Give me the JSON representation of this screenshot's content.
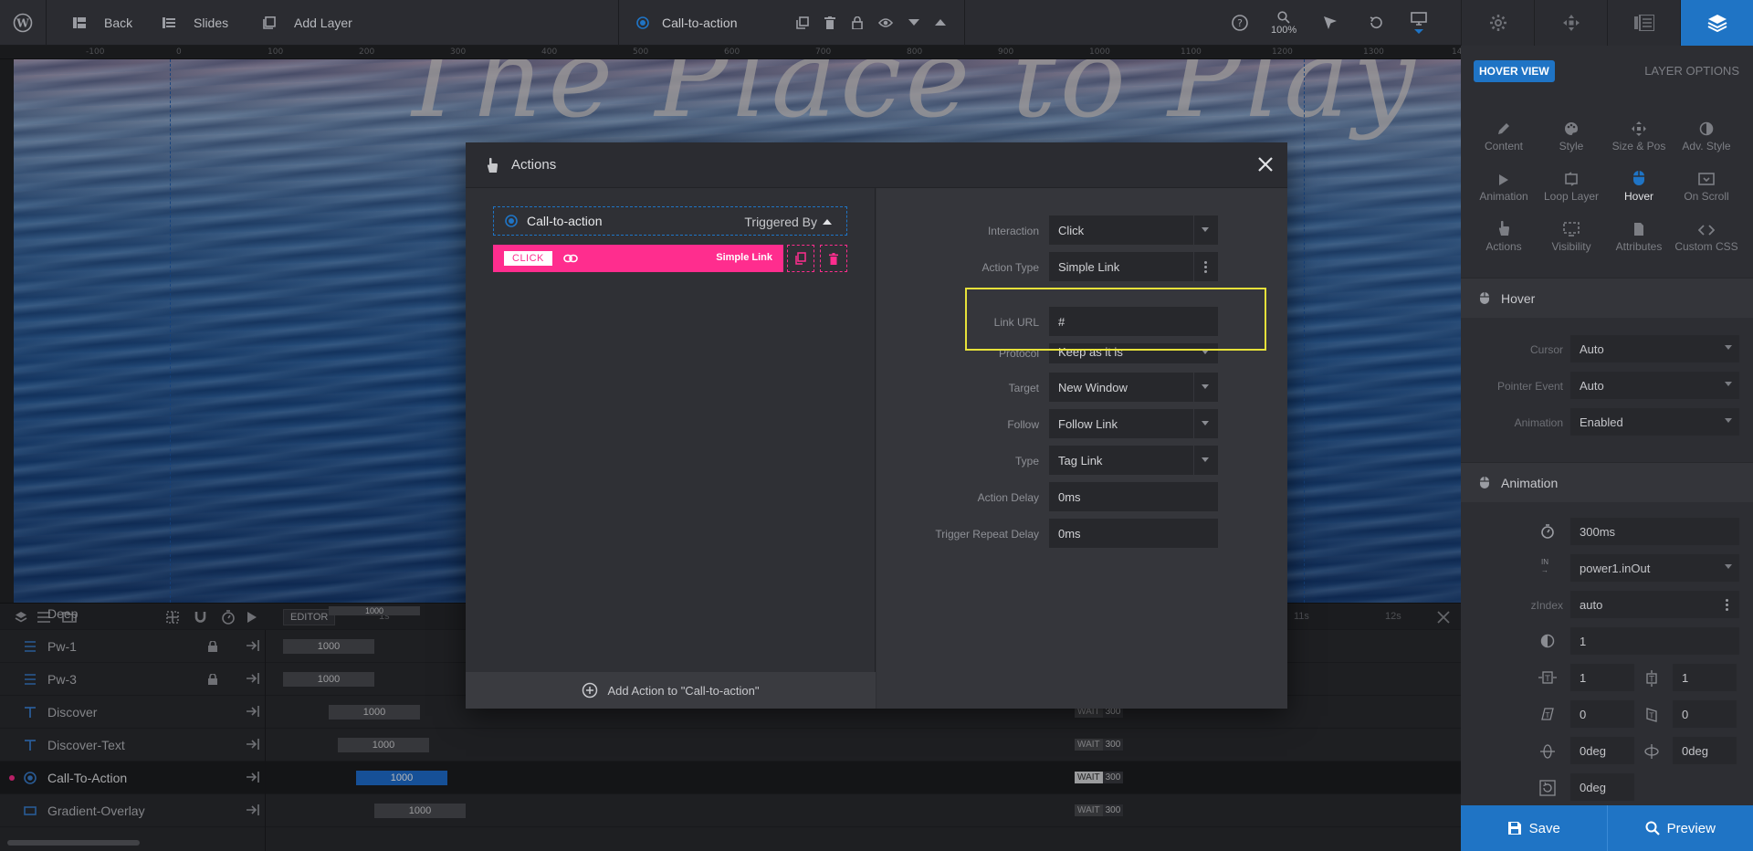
{
  "topbar": {
    "back": "Back",
    "slides": "Slides",
    "add_layer": "Add Layer",
    "current_layer": "Call-to-action",
    "zoom": "100%"
  },
  "ruler": [
    "-100",
    "0",
    "100",
    "200",
    "300",
    "400",
    "500",
    "600",
    "700",
    "800",
    "900",
    "1000",
    "1100",
    "1200",
    "1300",
    "14"
  ],
  "canvas": {
    "title_text": "The Place to Play"
  },
  "timeline": {
    "editor_label": "EDITOR",
    "time_1s": "1s",
    "time_11s": "11s",
    "time_12s": "12s",
    "top_partial": {
      "name": "Deep",
      "duration": "1000"
    },
    "rows": [
      {
        "name": "Pw-1",
        "duration": "1000",
        "locked": true,
        "wait": "",
        "delay": ""
      },
      {
        "name": "Pw-3",
        "duration": "1000",
        "locked": true,
        "wait": "",
        "delay": ""
      },
      {
        "name": "Discover",
        "duration": "1000",
        "locked": false,
        "wait": "WAIT",
        "delay": "300"
      },
      {
        "name": "Discover-Text",
        "duration": "1000",
        "locked": false,
        "wait": "WAIT",
        "delay": "300"
      },
      {
        "name": "Call-To-Action",
        "duration": "1000",
        "locked": false,
        "wait": "WAIT",
        "delay": "300",
        "selected": true
      },
      {
        "name": "Gradient-Overlay",
        "duration": "1000",
        "locked": false,
        "wait": "WAIT",
        "delay": "300"
      }
    ]
  },
  "right_panel": {
    "hover_view": "HOVER VIEW",
    "layer_options": "LAYER OPTIONS",
    "options": [
      {
        "label": "Content",
        "icon": "pen-icon"
      },
      {
        "label": "Style",
        "icon": "palette-icon"
      },
      {
        "label": "Size & Pos",
        "icon": "move-icon"
      },
      {
        "label": "Adv. Style",
        "icon": "contrast-icon"
      },
      {
        "label": "Animation",
        "icon": "play-icon"
      },
      {
        "label": "Loop Layer",
        "icon": "loop-icon"
      },
      {
        "label": "Hover",
        "icon": "mouse-icon",
        "active": true
      },
      {
        "label": "On Scroll",
        "icon": "scroll-icon"
      },
      {
        "label": "Actions",
        "icon": "hand-icon"
      },
      {
        "label": "Visibility",
        "icon": "visibility-icon"
      },
      {
        "label": "Attributes",
        "icon": "attributes-icon"
      },
      {
        "label": "Custom CSS",
        "icon": "code-icon"
      }
    ],
    "hover_section": "Hover",
    "cursor_label": "Cursor",
    "cursor_value": "Auto",
    "pointer_label": "Pointer Event",
    "pointer_value": "Auto",
    "animation_label": "Animation",
    "animation_value": "Enabled",
    "animation_section": "Animation",
    "speed": "300ms",
    "ease": "power1.inOut",
    "zindex_label": "zIndex",
    "zindex": "auto",
    "opacity": "1",
    "scale_x": "1",
    "scale_y": "1",
    "skew_x": "0",
    "skew_y": "0",
    "rotate_x": "0deg",
    "rotate_y": "0deg",
    "rotate_z": "0deg",
    "ease_in_label": "IN",
    "save": "Save",
    "preview": "Preview"
  },
  "modal": {
    "title": "Actions",
    "trigger_layer": "Call-to-action",
    "triggered_by": "Triggered By",
    "action_event": "CLICK",
    "action_type_label": "Simple Link",
    "add_action": "Add Action to \"Call-to-action\"",
    "fields": [
      {
        "label": "Interaction",
        "value": "Click",
        "control": "select"
      },
      {
        "label": "Action Type",
        "value": "Simple Link",
        "control": "menu"
      },
      {
        "label": "Link URL",
        "value": "#",
        "control": "input"
      },
      {
        "label": "Protocol",
        "value": "Keep as it is",
        "control": "select"
      },
      {
        "label": "Target",
        "value": "New Window",
        "control": "select"
      },
      {
        "label": "Follow",
        "value": "Follow Link",
        "control": "select"
      },
      {
        "label": "Type",
        "value": "Tag Link",
        "control": "select"
      },
      {
        "label": "Action Delay",
        "value": "0ms",
        "control": "input"
      },
      {
        "label": "Trigger Repeat Delay",
        "value": "0ms",
        "control": "input"
      }
    ]
  },
  "colors": {
    "accent": "#1f74c5",
    "action_pink": "#ff2d8e",
    "highlight": "#e6e13a"
  }
}
